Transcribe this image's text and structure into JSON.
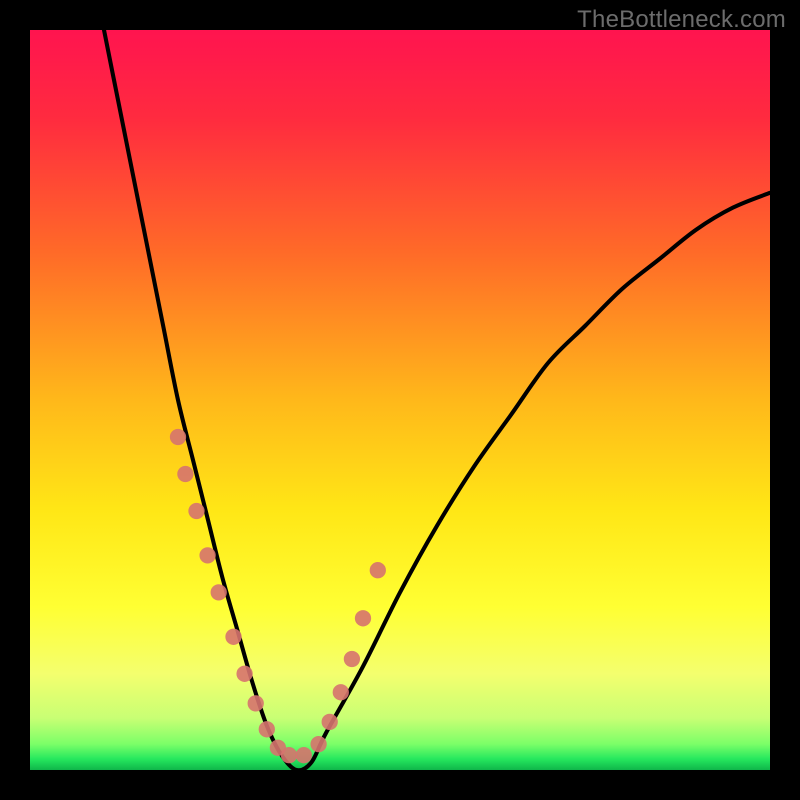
{
  "watermark": "TheBottleneck.com",
  "gradient_stops": [
    {
      "offset": 0.0,
      "color": "#ff144f"
    },
    {
      "offset": 0.12,
      "color": "#ff2b3f"
    },
    {
      "offset": 0.3,
      "color": "#ff6a28"
    },
    {
      "offset": 0.5,
      "color": "#ffb81a"
    },
    {
      "offset": 0.65,
      "color": "#ffe716"
    },
    {
      "offset": 0.78,
      "color": "#ffff33"
    },
    {
      "offset": 0.87,
      "color": "#f4ff6e"
    },
    {
      "offset": 0.93,
      "color": "#c8ff74"
    },
    {
      "offset": 0.965,
      "color": "#7bff68"
    },
    {
      "offset": 0.985,
      "color": "#26e85e"
    },
    {
      "offset": 1.0,
      "color": "#0fb64a"
    }
  ],
  "chart_data": {
    "type": "line",
    "title": "",
    "xlabel": "",
    "ylabel": "",
    "xlim": [
      0,
      100
    ],
    "ylim": [
      0,
      100
    ],
    "grid": false,
    "legend": false,
    "series": [
      {
        "name": "bottleneck-curve",
        "color": "#000000",
        "x": [
          10,
          12,
          14,
          16,
          18,
          20,
          22,
          24,
          26,
          28,
          30,
          32,
          34,
          36,
          38,
          40,
          45,
          50,
          55,
          60,
          65,
          70,
          75,
          80,
          85,
          90,
          95,
          100
        ],
        "y": [
          100,
          90,
          80,
          70,
          60,
          50,
          42,
          34,
          26,
          19,
          12,
          6,
          2,
          0,
          1,
          5,
          14,
          24,
          33,
          41,
          48,
          55,
          60,
          65,
          69,
          73,
          76,
          78
        ]
      }
    ],
    "markers": {
      "name": "curve-points",
      "color": "#d6736e",
      "radius_pct": 1.1,
      "x": [
        20.0,
        21.0,
        22.5,
        24.0,
        25.5,
        27.5,
        29.0,
        30.5,
        32.0,
        33.5,
        35.0,
        37.0,
        39.0,
        40.5,
        42.0,
        43.5,
        45.0,
        47.0
      ],
      "y": [
        45.0,
        40.0,
        35.0,
        29.0,
        24.0,
        18.0,
        13.0,
        9.0,
        5.5,
        3.0,
        2.0,
        2.0,
        3.5,
        6.5,
        10.5,
        15.0,
        20.5,
        27.0
      ]
    }
  }
}
